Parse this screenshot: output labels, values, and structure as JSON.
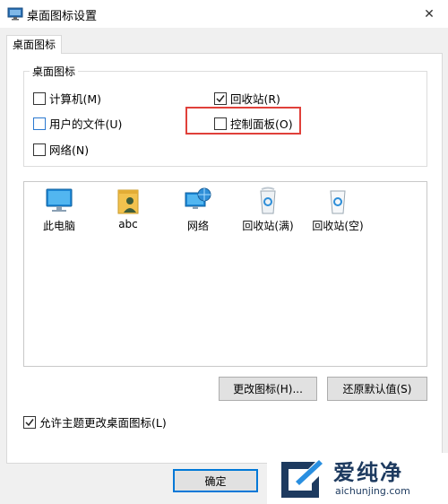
{
  "window": {
    "title": "桌面图标设置",
    "close_glyph": "✕"
  },
  "tab": {
    "label": "桌面图标"
  },
  "group": {
    "legend": "桌面图标",
    "checkboxes": [
      {
        "label": "计算机(M)",
        "checked": false
      },
      {
        "label": "回收站(R)",
        "checked": true
      },
      {
        "label": "用户的文件(U)",
        "checked": false
      },
      {
        "label": "控制面板(O)",
        "checked": false
      },
      {
        "label": "网络(N)",
        "checked": false
      }
    ]
  },
  "icon_list": [
    {
      "label": "此电脑",
      "icon": "computer-icon"
    },
    {
      "label": "abc",
      "icon": "user-folder-icon"
    },
    {
      "label": "网络",
      "icon": "network-icon"
    },
    {
      "label": "回收站(满)",
      "icon": "recycle-bin-full-icon"
    },
    {
      "label": "回收站(空)",
      "icon": "recycle-bin-empty-icon"
    }
  ],
  "buttons": {
    "change_icon": "更改图标(H)...",
    "restore_default": "还原默认值(S)",
    "ok": "确定"
  },
  "theme_checkbox": {
    "label": "允许主题更改桌面图标(L)",
    "checked": true
  },
  "watermark": {
    "cn": "爱纯净",
    "en": "aichunjing.com"
  },
  "colors": {
    "highlight": "#e0403a",
    "primary_border": "#0078d7",
    "dialog_bg": "#f0f0f0"
  }
}
